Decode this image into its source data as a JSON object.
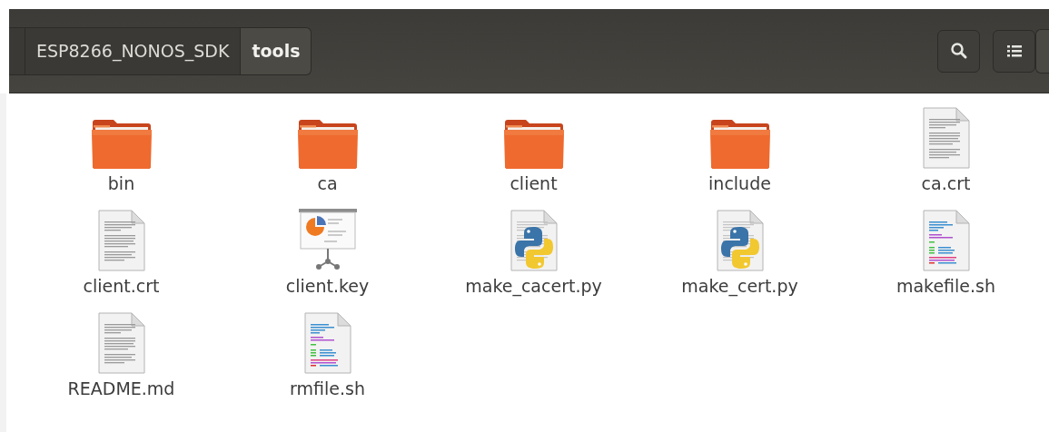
{
  "breadcrumbs": [
    {
      "label": "ESP8266_NONOS_SDK",
      "selected": false
    },
    {
      "label": "tools",
      "selected": true
    }
  ],
  "files": [
    {
      "name": "bin",
      "kind": "folder"
    },
    {
      "name": "ca",
      "kind": "folder"
    },
    {
      "name": "client",
      "kind": "folder"
    },
    {
      "name": "include",
      "kind": "folder"
    },
    {
      "name": "ca.crt",
      "kind": "text"
    },
    {
      "name": "client.crt",
      "kind": "text"
    },
    {
      "name": "client.key",
      "kind": "presentation"
    },
    {
      "name": "make_cacert.py",
      "kind": "python"
    },
    {
      "name": "make_cert.py",
      "kind": "python"
    },
    {
      "name": "makefile.sh",
      "kind": "script"
    },
    {
      "name": "README.md",
      "kind": "text"
    },
    {
      "name": "rmfile.sh",
      "kind": "script"
    }
  ]
}
